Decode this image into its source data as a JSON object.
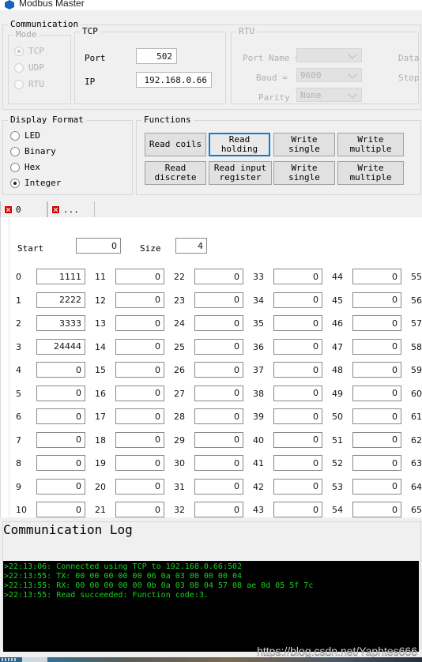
{
  "window": {
    "title": "Modbus Master",
    "icon": "app-shield-icon"
  },
  "communication": {
    "legend": "Communication",
    "mode": {
      "legend": "Mode",
      "disabled": true,
      "options": [
        {
          "label": "TCP",
          "checked": true
        },
        {
          "label": "UDP",
          "checked": false
        },
        {
          "label": "RTU",
          "checked": false
        }
      ]
    },
    "tcp": {
      "legend": "TCP",
      "port_label": "Port",
      "port_value": "502",
      "ip_label": "IP",
      "ip_value": "192.168.0.66"
    },
    "rtu": {
      "legend": "RTU",
      "disabled": true,
      "port_name_label": "Port Name =",
      "port_name_value": "",
      "baud_label": "Baud =",
      "baud_value": "9600",
      "parity_label": "Parity",
      "parity_value": "None",
      "data_label": "Data",
      "stop_label": "Stop"
    }
  },
  "display_format": {
    "legend": "Display Format",
    "options": [
      {
        "label": "LED",
        "checked": false
      },
      {
        "label": "Binary",
        "checked": false
      },
      {
        "label": "Hex",
        "checked": false
      },
      {
        "label": "Integer",
        "checked": true
      }
    ]
  },
  "functions": {
    "legend": "Functions",
    "buttons": [
      {
        "label": "Read coils",
        "focused": false
      },
      {
        "label": "Read\nholding",
        "focused": true
      },
      {
        "label": "Write\nsingle",
        "focused": false
      },
      {
        "label": "Write\nmultiple",
        "focused": false
      },
      {
        "label": "Read\ndiscrete",
        "focused": false
      },
      {
        "label": "Read input\nregister",
        "focused": false
      },
      {
        "label": "Write\nsingle",
        "focused": false
      },
      {
        "label": "Write\nmultiple",
        "focused": false
      }
    ]
  },
  "tabs": {
    "items": [
      {
        "label": "0",
        "active": false
      },
      {
        "label": "...",
        "active": true
      }
    ]
  },
  "registers": {
    "start_label": "Start",
    "start_value": "0",
    "size_label": "Size",
    "size_value": "4",
    "columns": [
      {
        "indices": [
          "0",
          "1",
          "2",
          "3",
          "4",
          "5",
          "6",
          "7",
          "8",
          "9",
          "10"
        ],
        "values": [
          "1111",
          "2222",
          "3333",
          "24444",
          "0",
          "0",
          "0",
          "0",
          "0",
          "0",
          "0"
        ]
      },
      {
        "indices": [
          "11",
          "12",
          "13",
          "14",
          "15",
          "16",
          "17",
          "18",
          "19",
          "20",
          "21"
        ],
        "values": [
          "0",
          "0",
          "0",
          "0",
          "0",
          "0",
          "0",
          "0",
          "0",
          "0",
          "0"
        ]
      },
      {
        "indices": [
          "22",
          "23",
          "24",
          "25",
          "26",
          "27",
          "28",
          "29",
          "30",
          "31",
          "32"
        ],
        "values": [
          "0",
          "0",
          "0",
          "0",
          "0",
          "0",
          "0",
          "0",
          "0",
          "0",
          "0"
        ]
      },
      {
        "indices": [
          "33",
          "34",
          "35",
          "36",
          "37",
          "38",
          "39",
          "40",
          "41",
          "42",
          "43"
        ],
        "values": [
          "0",
          "0",
          "0",
          "0",
          "0",
          "0",
          "0",
          "0",
          "0",
          "0",
          "0"
        ]
      },
      {
        "indices": [
          "44",
          "45",
          "46",
          "47",
          "48",
          "49",
          "50",
          "51",
          "52",
          "53",
          "54"
        ],
        "values": [
          "0",
          "0",
          "0",
          "0",
          "0",
          "0",
          "0",
          "0",
          "0",
          "0",
          "0"
        ]
      },
      {
        "indices": [
          "55",
          "56",
          "57",
          "58",
          "59",
          "60",
          "61",
          "62",
          "63",
          "64",
          "65"
        ],
        "values": [
          "0",
          "0",
          "0",
          "0",
          "0",
          "0",
          "0",
          "0",
          "0",
          "0",
          "0"
        ]
      }
    ]
  },
  "log": {
    "legend": "Communication Log",
    "lines": [
      ">22:13:06: Connected using TCP to 192.168.0.66:502",
      ">22:13:55: TX: 00 00 00 00 00 06 0a 03 00 00 00 04",
      ">22:13:55: RX: 00 00 00 00 00 0b 0a 03 08 04 57 08 ae 0d 05 5f 7c",
      ">22:13:55: Read succeeded: Function code:3."
    ],
    "text_color": "#19d21e",
    "bg_color": "#000000"
  },
  "watermark": {
    "text": "https://blog.csdn.net/Yaphtes666"
  }
}
